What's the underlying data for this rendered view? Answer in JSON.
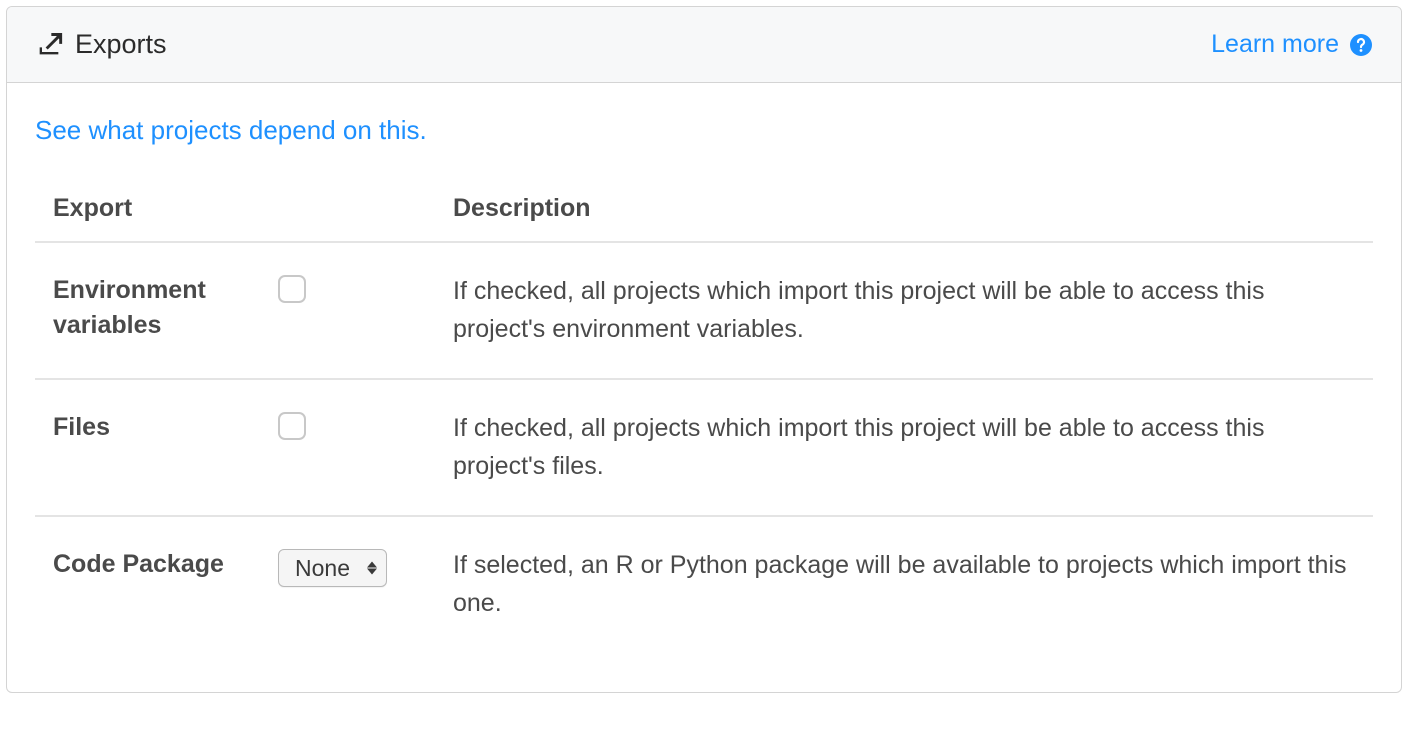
{
  "header": {
    "title": "Exports",
    "learn_more": "Learn more"
  },
  "body": {
    "depends_link": "See what projects depend on this."
  },
  "table": {
    "headers": {
      "export": "Export",
      "description": "Description"
    },
    "rows": [
      {
        "label": "Environment variables",
        "control_type": "checkbox",
        "checked": false,
        "description": "If checked, all projects which import this project will be able to access this project's environment variables."
      },
      {
        "label": "Files",
        "control_type": "checkbox",
        "checked": false,
        "description": "If checked, all projects which import this project will be able to access this project's files."
      },
      {
        "label": "Code Package",
        "control_type": "select",
        "selected": "None",
        "description": "If selected, an R or Python package will be available to projects which import this one."
      }
    ]
  }
}
